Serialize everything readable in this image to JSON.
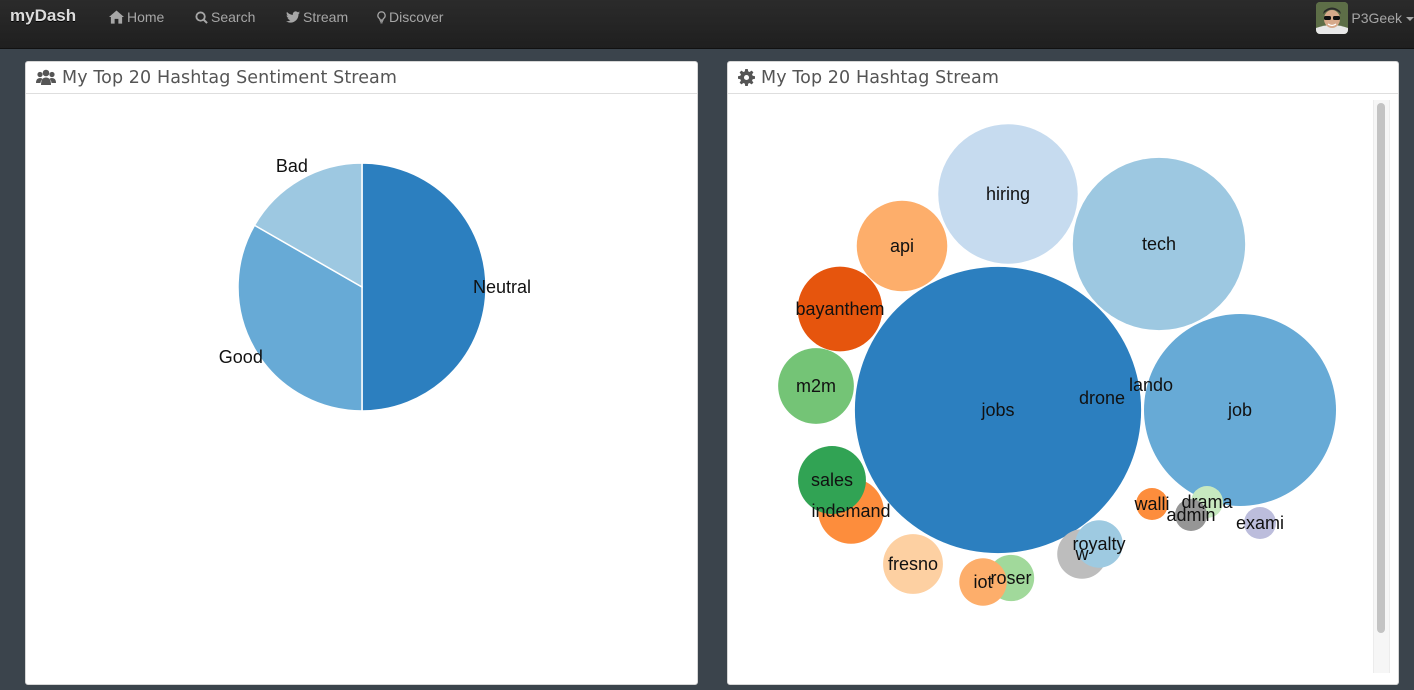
{
  "navbar": {
    "brand": "myDash",
    "items": [
      {
        "label": "Home",
        "icon": "home-icon"
      },
      {
        "label": "Search",
        "icon": "search-icon"
      },
      {
        "label": "Stream",
        "icon": "twitter-icon"
      },
      {
        "label": "Discover",
        "icon": "lightbulb-icon"
      }
    ],
    "user": {
      "name": "P3Geek",
      "icon": "caret-down-icon"
    }
  },
  "panels": {
    "sentiment": {
      "title": "My Top 20 Hashtag Sentiment Stream",
      "icon": "users-icon"
    },
    "hashtags": {
      "title": "My Top 20 Hashtag Stream",
      "icon": "gear-icon"
    }
  },
  "chart_data": [
    {
      "type": "pie",
      "title": "My Top 20 Hashtag Sentiment Stream",
      "categories": [
        "Neutral",
        "Good",
        "Bad"
      ],
      "values": [
        50,
        33.3,
        16.7
      ],
      "unit": "percent",
      "colors": [
        "#2c7fbf",
        "#67aad6",
        "#9dc8e1"
      ],
      "legend": "none",
      "labels": "outside-slices"
    },
    {
      "type": "bubble",
      "title": "My Top 20 Hashtag Stream",
      "legend": "none",
      "series": [
        {
          "name": "jobs",
          "value": 80,
          "color": "#2c7fbf"
        },
        {
          "name": "job",
          "value": 36,
          "color": "#67aad6"
        },
        {
          "name": "tech",
          "value": 29,
          "color": "#9dc8e1"
        },
        {
          "name": "hiring",
          "value": 19,
          "color": "#c6dbef"
        },
        {
          "name": "api",
          "value": 8,
          "color": "#fdae6b"
        },
        {
          "name": "bayanthem",
          "value": 7,
          "color": "#e6550d"
        },
        {
          "name": "m2m",
          "value": 5.6,
          "color": "#74c476"
        },
        {
          "name": "indemand",
          "value": 4.2,
          "color": "#fd8d3c"
        },
        {
          "name": "sales",
          "value": 4.5,
          "color": "#31a354"
        },
        {
          "name": "fresno",
          "value": 3.5,
          "color": "#fdd0a2"
        },
        {
          "name": "roser",
          "value": 2.1,
          "color": "#a1d99b"
        },
        {
          "name": "iot",
          "value": 2.2,
          "color": "#fdae6b"
        },
        {
          "name": "w",
          "value": 2.4,
          "color": "#bdbdbd"
        },
        {
          "name": "royalty",
          "value": 2.2,
          "color": "#9ecae1"
        },
        {
          "name": "walli",
          "value": 1,
          "color": "#fd8d3c"
        },
        {
          "name": "drama",
          "value": 1,
          "color": "#c7e9c0"
        },
        {
          "name": "admin",
          "value": 1,
          "color": "#969696"
        },
        {
          "name": "exami",
          "value": 1,
          "color": "#bcbddc"
        },
        {
          "name": "drone",
          "value": 1,
          "color": "#2c7fbf"
        },
        {
          "name": "lando",
          "value": 1,
          "color": "#2c7fbf"
        }
      ]
    }
  ]
}
